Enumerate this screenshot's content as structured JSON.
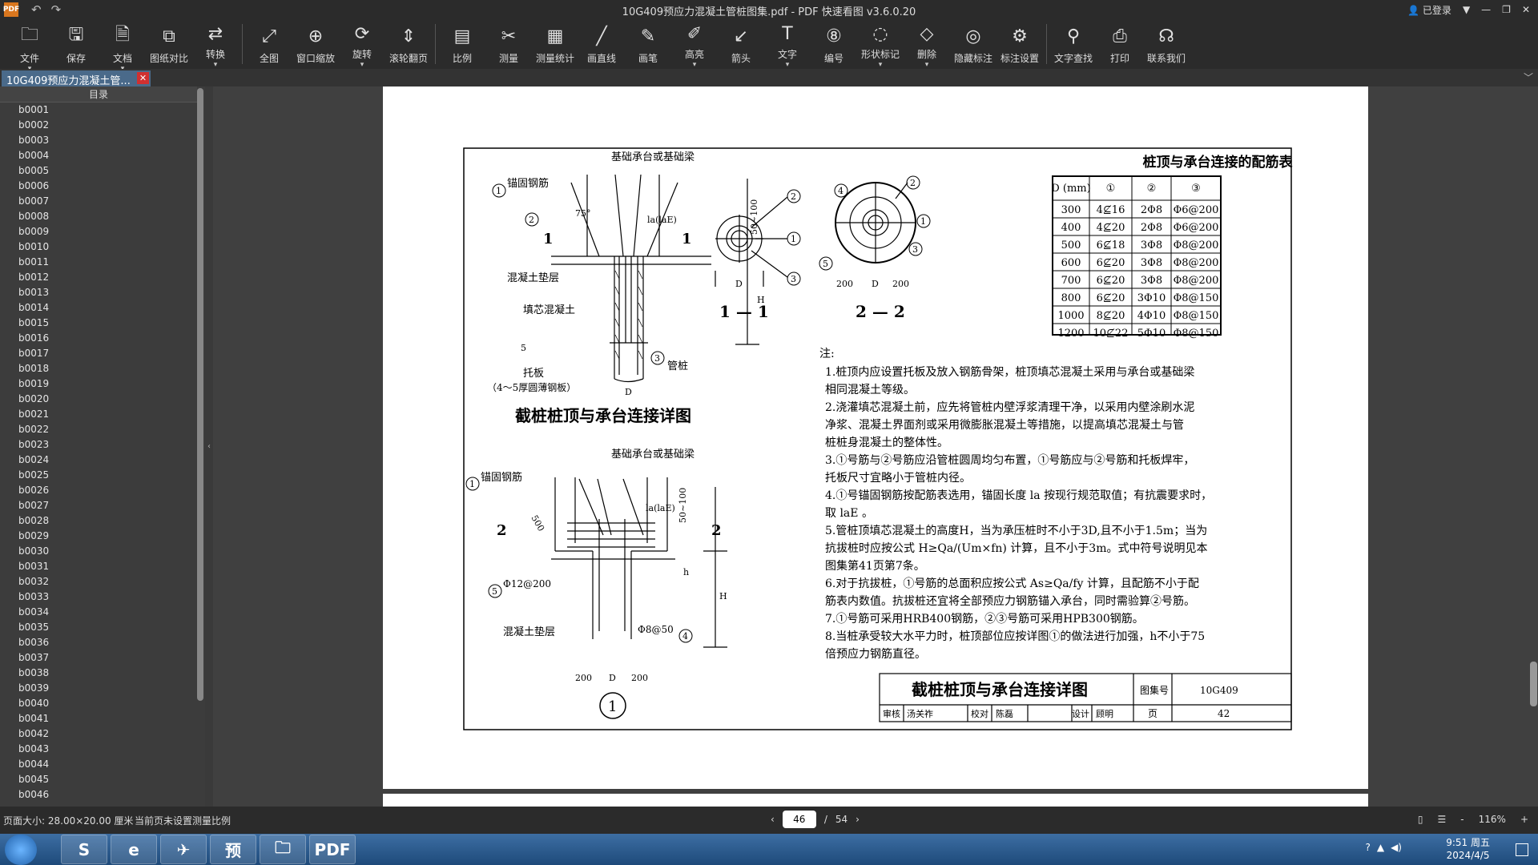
{
  "app": {
    "logo": "PDF",
    "title": "10G409预应力混凝土管桩图集.pdf - PDF 快速看图 v3.6.0.20",
    "login": "已登录"
  },
  "toolbar": [
    {
      "label": "文件",
      "icon": "folder-icon",
      "glyph": "🗀",
      "dropdown": true
    },
    {
      "label": "保存",
      "icon": "save-icon",
      "glyph": "🖫",
      "dropdown": false
    },
    {
      "label": "文档",
      "icon": "document-icon",
      "glyph": "🗎",
      "dropdown": true
    },
    {
      "label": "图纸对比",
      "icon": "compare-icon",
      "glyph": "⧉",
      "dropdown": false
    },
    {
      "label": "转换",
      "icon": "convert-icon",
      "glyph": "⇄",
      "dropdown": true
    },
    {
      "label": "全图",
      "icon": "fullview-icon",
      "glyph": "⤢",
      "dropdown": false
    },
    {
      "label": "窗口缩放",
      "icon": "zoom-window-icon",
      "glyph": "⊕",
      "dropdown": false
    },
    {
      "label": "旋转",
      "icon": "rotate-icon",
      "glyph": "⟳",
      "dropdown": true
    },
    {
      "label": "滚轮翻页",
      "icon": "scroll-icon",
      "glyph": "⇕",
      "dropdown": false
    },
    {
      "label": "比例",
      "icon": "scale-icon",
      "glyph": "▤",
      "dropdown": false
    },
    {
      "label": "测量",
      "icon": "measure-icon",
      "glyph": "✂",
      "dropdown": false
    },
    {
      "label": "测量统计",
      "icon": "measure-stats-icon",
      "glyph": "▦",
      "dropdown": false
    },
    {
      "label": "画直线",
      "icon": "line-icon",
      "glyph": "╱",
      "dropdown": false
    },
    {
      "label": "画笔",
      "icon": "pen-icon",
      "glyph": "✎",
      "dropdown": false
    },
    {
      "label": "高亮",
      "icon": "highlight-icon",
      "glyph": "✐",
      "dropdown": true
    },
    {
      "label": "箭头",
      "icon": "arrow-icon",
      "glyph": "↙",
      "dropdown": false
    },
    {
      "label": "文字",
      "icon": "text-icon",
      "glyph": "T",
      "dropdown": true
    },
    {
      "label": "编号",
      "icon": "number-icon",
      "glyph": "⑧",
      "dropdown": false
    },
    {
      "label": "形状标记",
      "icon": "shape-icon",
      "glyph": "◌",
      "dropdown": true
    },
    {
      "label": "删除",
      "icon": "eraser-icon",
      "glyph": "◇",
      "dropdown": true
    },
    {
      "label": "隐藏标注",
      "icon": "hide-icon",
      "glyph": "◎",
      "dropdown": false
    },
    {
      "label": "标注设置",
      "icon": "annotation-settings-icon",
      "glyph": "⚙",
      "dropdown": false
    },
    {
      "label": "文字查找",
      "icon": "search-icon",
      "glyph": "⚲",
      "dropdown": false
    },
    {
      "label": "打印",
      "icon": "print-icon",
      "glyph": "⎙",
      "dropdown": false
    },
    {
      "label": "联系我们",
      "icon": "headset-icon",
      "glyph": "☊",
      "dropdown": false
    }
  ],
  "tab": {
    "label": "10G409预应力混凝土管..."
  },
  "sidebar": {
    "title": "目录",
    "items": [
      "b0001",
      "b0002",
      "b0003",
      "b0004",
      "b0005",
      "b0006",
      "b0007",
      "b0008",
      "b0009",
      "b0010",
      "b0011",
      "b0012",
      "b0013",
      "b0014",
      "b0015",
      "b0016",
      "b0017",
      "b0018",
      "b0019",
      "b0020",
      "b0021",
      "b0022",
      "b0023",
      "b0024",
      "b0025",
      "b0026",
      "b0027",
      "b0028",
      "b0029",
      "b0030",
      "b0031",
      "b0032",
      "b0033",
      "b0034",
      "b0035",
      "b0036",
      "b0037",
      "b0038",
      "b0039",
      "b0040",
      "b0041",
      "b0042",
      "b0043",
      "b0044",
      "b0045",
      "b0046"
    ]
  },
  "drawing": {
    "detail_title": "截桩桩顶与承台连接详图",
    "labels": {
      "cap": "基础承台或基础梁",
      "anchor": "锚固钢筋",
      "pad": "混凝土垫层",
      "fill": "填芯混凝土",
      "plate": "托板",
      "plate_note": "（4～5厚圆薄钢板）",
      "pipe": "管桩",
      "ring": "Φ12@200",
      "spiral": "Φ8@50",
      "dim_50_100": "50~100",
      "dim_H": "H",
      "dim_h": "h",
      "dim_D": "D",
      "dim_200": "200",
      "dim_500": "500",
      "angle": "75°",
      "la": "la(laE)",
      "five": "5",
      "sec11": "1 — 1",
      "sec22": "2 — 2",
      "mark1": "1",
      "mark2": "2",
      "circle1": "1"
    },
    "table": {
      "title": "桩顶与承台连接的配筋表",
      "header": [
        "D (mm)",
        "①",
        "②",
        "③"
      ],
      "rows": [
        [
          "300",
          "4⊈16",
          "2Φ8",
          "Φ6@200"
        ],
        [
          "400",
          "4⊈20",
          "2Φ8",
          "Φ6@200"
        ],
        [
          "500",
          "6⊈18",
          "3Φ8",
          "Φ8@200"
        ],
        [
          "600",
          "6⊈20",
          "3Φ8",
          "Φ8@200"
        ],
        [
          "700",
          "6⊈20",
          "3Φ8",
          "Φ8@200"
        ],
        [
          "800",
          "6⊈20",
          "3Φ10",
          "Φ8@150"
        ],
        [
          "1000",
          "8⊈20",
          "4Φ10",
          "Φ8@150"
        ],
        [
          "1200",
          "10⊈22",
          "5Φ10",
          "Φ8@150"
        ]
      ]
    },
    "notes_title": "注:",
    "notes": [
      "1.桩顶内应设置托板及放入钢筋骨架，桩顶填芯混凝土采用与承台或基础梁",
      "   相同混凝土等级。",
      "2.浇灌填芯混凝土前，应先将管桩内壁浮浆清理干净，以采用内壁涂刷水泥",
      "   净浆、混凝土界面剂或采用微膨胀混凝土等措施，以提高填芯混凝土与管",
      "   桩桩身混凝土的整体性。",
      "3.①号筋与②号筋应沿管桩圆周均匀布置，①号筋应与②号筋和托板焊牢，",
      "   托板尺寸宜略小于管桩内径。",
      "4.①号锚固钢筋按配筋表选用，锚固长度 la 按现行规范取值；有抗震要求时，",
      "   取 laE 。",
      "5.管桩顶填芯混凝土的高度H，当为承压桩时不小于3D,且不小于1.5m；当为",
      "   抗拔桩时应按公式 H≥Qa/(Um×fn) 计算，且不小于3m。式中符号说明见本",
      "   图集第41页第7条。",
      "6.对于抗拔桩，①号筋的总面积应按公式 As≥Qa/fy 计算，且配筋不小于配",
      "   筋表内数值。抗拔桩还宜将全部预应力钢筋锚入承台，同时需验算②号筋。",
      "7.①号筋可采用HRB400钢筋，②③号筋可采用HPB300钢筋。",
      "8.当桩承受较大水平力时，桩顶部位应按详图①的做法进行加强，h不小于75",
      "   倍预应力钢筋直径。"
    ],
    "titleblock": {
      "name": "截桩桩顶与承台连接详图",
      "atlas_label": "图集号",
      "atlas_no": "10G409",
      "review_label": "审核",
      "reviewer": "汤关祚",
      "check_label": "校对",
      "checker": "陈磊",
      "design_label": "设计",
      "designer": "顾明",
      "page_label": "页",
      "page_no": "42"
    }
  },
  "status": {
    "page_size": "页面大小: 28.00×20.00 厘米",
    "scale_note": "当前页未设置测量比例",
    "current_page": "46",
    "page_sep": "/",
    "total_pages": "54",
    "zoom": "116%"
  },
  "taskbar": {
    "apps": [
      "S",
      "e",
      "✈",
      "预",
      "🗀",
      "PDF"
    ],
    "time": "9:51 周五",
    "date": "2024/4/5"
  }
}
